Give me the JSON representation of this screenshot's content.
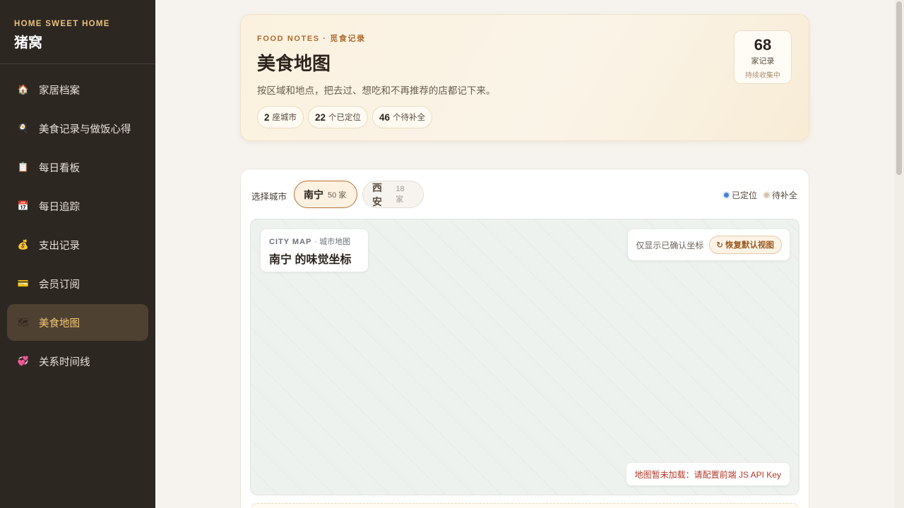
{
  "sidebar": {
    "brand_sub": "HOME SWEET HOME",
    "brand_title": "猪窝",
    "items": [
      {
        "icon": "house-icon",
        "glyph": "🏠",
        "label": "家居档案"
      },
      {
        "icon": "magnifier-icon",
        "glyph": "🍳",
        "label": "美食记录与做饭心得"
      },
      {
        "icon": "clipboard-icon",
        "glyph": "📋",
        "label": "每日看板"
      },
      {
        "icon": "calendar-icon",
        "glyph": "📅",
        "label": "每日追踪"
      },
      {
        "icon": "money-bag-icon",
        "glyph": "💰",
        "label": "支出记录"
      },
      {
        "icon": "credit-card-icon",
        "glyph": "💳",
        "label": "会员订阅"
      },
      {
        "icon": "map-icon",
        "glyph": "🗺",
        "label": "美食地图",
        "active": true
      },
      {
        "icon": "heart-icon",
        "glyph": "💞",
        "label": "关系时间线"
      }
    ]
  },
  "hero": {
    "subtitle": "FOOD NOTES · 觅食记录",
    "title": "美食地图",
    "description": "按区域和地点，把去过、想吃和不再推荐的店都记下来。",
    "stats": [
      {
        "value": "2",
        "label": "座城市"
      },
      {
        "value": "22",
        "label": "个已定位"
      },
      {
        "value": "46",
        "label": "个待补全"
      }
    ],
    "count": {
      "value": "68",
      "label": "家记录",
      "sub": "持续收集中"
    }
  },
  "map_card": {
    "city_label": "选择城市",
    "cities": [
      {
        "name": "南宁",
        "count": "50 家",
        "active": true
      },
      {
        "name": "西安",
        "count": "18 家",
        "active": false
      }
    ],
    "legend": [
      {
        "label": "已定位",
        "color": "#4b7fd6"
      },
      {
        "label": "待补全",
        "color": "#d6c4ae"
      }
    ],
    "map": {
      "sub_title": "CITY MAP",
      "sub_title_cn": "· 城市地图",
      "title": "南宁 的味觉坐标",
      "filter_label": "仅显示已确认坐标",
      "reset_label": "恢复默认视图",
      "error": "地图暂未加载：请配置前端 JS API Key"
    }
  }
}
